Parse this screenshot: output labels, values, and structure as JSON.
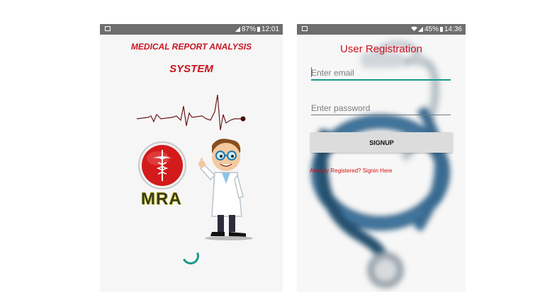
{
  "splash": {
    "status": {
      "signal_icon": "signal-icon",
      "battery": "87%",
      "time": "12:01"
    },
    "title_line1": "MEDICAL REPORT ANALYSIS",
    "title_line2": "SYSTEM",
    "logo_text": "MRA",
    "accent_color": "#c8141e",
    "spinner_color": "#17968a"
  },
  "registration": {
    "status": {
      "battery": "45%",
      "time": "14:36"
    },
    "title": "User Registration",
    "email_placeholder": "Enter email",
    "password_placeholder": "Enter password",
    "signup_label": "SIGNUP",
    "login_link": "Already Registered? Signin Here",
    "accent_color": "#179a8c"
  }
}
